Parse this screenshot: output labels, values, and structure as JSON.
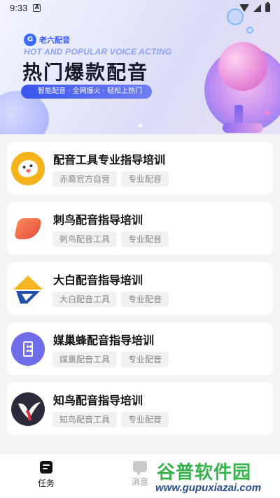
{
  "status_bar": {
    "time": "9:33",
    "notif_letter": "A"
  },
  "banner": {
    "brand": "老六配音",
    "brand_logo_letter": "G",
    "subtitle_en": "HOT AND POPULAR VOICE ACTING",
    "title": "热门爆款配音",
    "tagline": "智能配音 · 全网爆火 · 轻松上热门",
    "carousel_dots": 1
  },
  "cards": [
    {
      "title": "配音工具专业指导培训",
      "tags": [
        "赤裔官方自营",
        "专业配音"
      ],
      "icon": "cartoon-face-icon"
    },
    {
      "title": "刺鸟配音指导培训",
      "tags": [
        "刺鸟配音工具",
        "专业配音"
      ],
      "icon": "swift-bird-icon"
    },
    {
      "title": "大白配音指导培训",
      "tags": [
        "大白配音工具",
        "专业配音"
      ],
      "icon": "dabai-logo-icon"
    },
    {
      "title": "媒巢蜂配音指导培训",
      "tags": [
        "媒巢配音工具",
        "专业配音"
      ],
      "icon": "hive-icon"
    },
    {
      "title": "知鸟配音指导培训",
      "tags": [
        "知鸟配音工具",
        "专业配音"
      ],
      "icon": "zhiniao-bird-icon"
    }
  ],
  "nav": {
    "task_label": "任务",
    "message_label": "消息"
  },
  "watermark": {
    "name": "谷普软件园",
    "url": "www.gupuxiazai.com"
  },
  "colors": {
    "accent": "#3a56f0",
    "tag_bg": "#f1f1f3",
    "tag_text": "#888888",
    "watermark_green": "#36b24a"
  }
}
